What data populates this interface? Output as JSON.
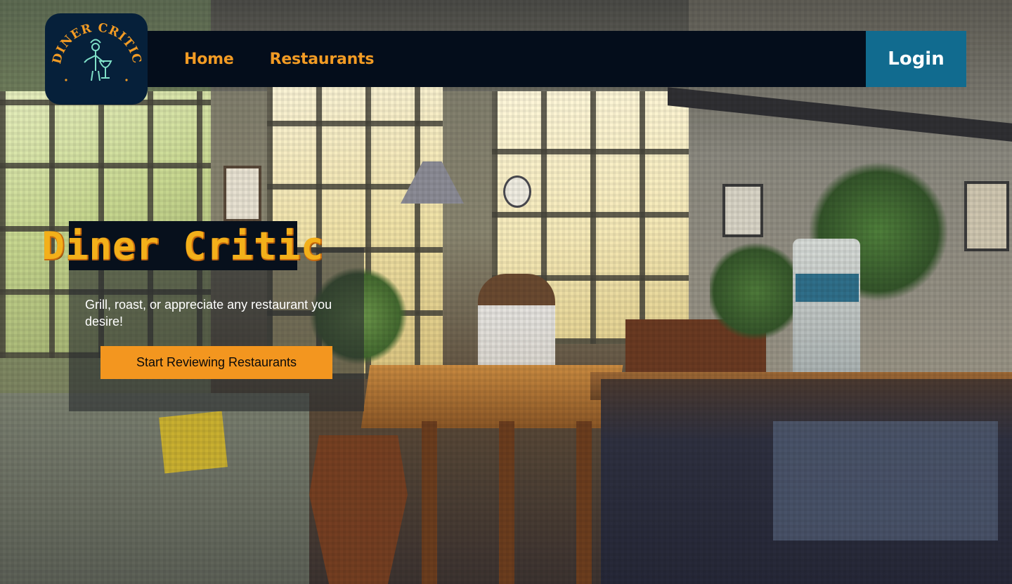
{
  "brand": {
    "logo_text": "DINER CRITIC",
    "hero_title": "Diner Critic"
  },
  "nav": {
    "items": [
      {
        "label": "Home"
      },
      {
        "label": "Restaurants"
      }
    ],
    "login_label": "Login"
  },
  "hero": {
    "subtitle": "Grill, roast, or appreciate any restaurant you desire!",
    "cta_label": "Start Reviewing Restaurants"
  },
  "colors": {
    "nav_bg": "#040d1b",
    "nav_link": "#f29b24",
    "login_bg": "#116b8f",
    "cta_bg": "#f3961f",
    "title": "#f3b01a"
  },
  "icons": {
    "logo": "chef-wine-glass-logo"
  }
}
